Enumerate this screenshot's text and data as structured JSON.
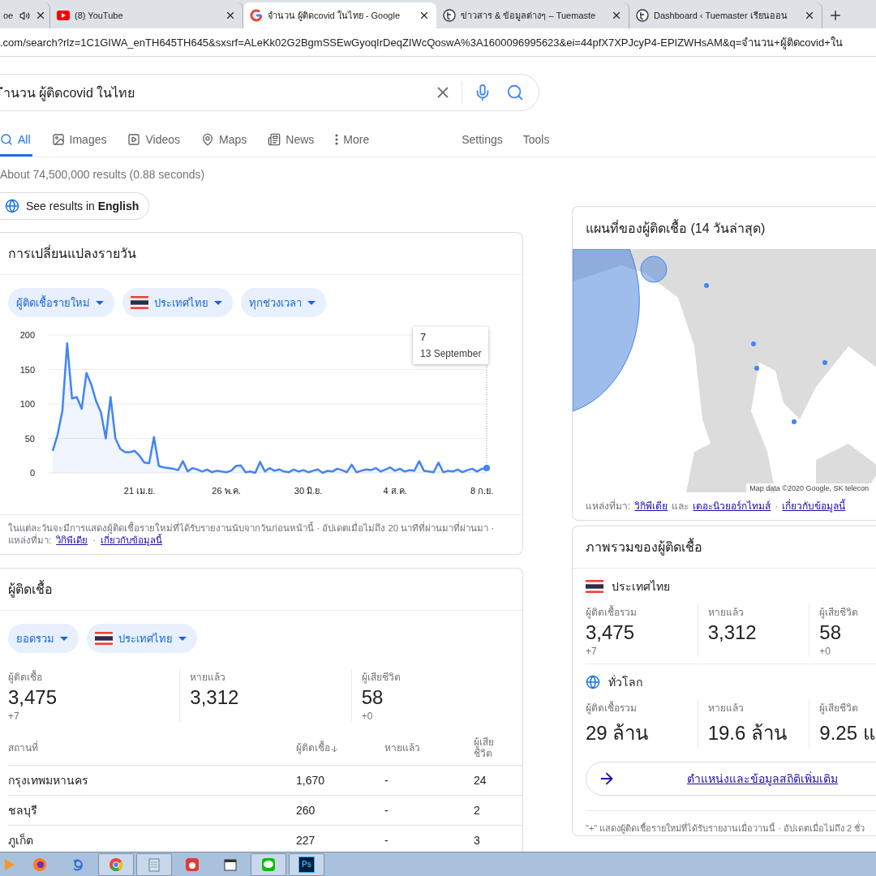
{
  "browser_tabs": [
    {
      "title": "oe",
      "kind": "audio",
      "selected": false
    },
    {
      "title": "(8) YouTube",
      "kind": "youtube",
      "selected": false
    },
    {
      "title": "จำนวน ผู้ติดcovid ในไทย - Google",
      "kind": "google",
      "selected": true
    },
    {
      "title": "ข่าวสาร & ข้อมูลต่างๆ – Tuemaste",
      "kind": "site",
      "selected": false
    },
    {
      "title": "Dashboard ‹ Tuemaster เรียนออน",
      "kind": "site",
      "selected": false
    }
  ],
  "address_bar": {
    "url": ".com/search?rlz=1C1GIWA_enTH645TH645&sxsrf=ALeKk02G2BgmSSEwGyoqIrDeqZIWcQoswA%3A1600096995623&ei=44pfX7XPJcyP4-EPIZWHsAM&q=จำนวน+ผู้ติดcovid+ใน"
  },
  "search": {
    "value": "ำนวน ผู้ติดcovid ในไทย"
  },
  "search_tabs": [
    {
      "label": "All",
      "kind": "all",
      "selected": true
    },
    {
      "label": "Images",
      "kind": "images",
      "selected": false
    },
    {
      "label": "Videos",
      "kind": "videos",
      "selected": false
    },
    {
      "label": "Maps",
      "kind": "maps",
      "selected": false
    },
    {
      "label": "News",
      "kind": "news",
      "selected": false
    },
    {
      "label": "More",
      "kind": "more",
      "selected": false
    }
  ],
  "search_tools": [
    "Settings",
    "Tools"
  ],
  "result_stats": "About 74,500,000 results (0.88 seconds)",
  "language_chip": "See results in **English**",
  "daily_card": {
    "title": "การเปลี่ยนแปลงรายวัน",
    "chips": [
      {
        "label": "ผู้ติดเชื้อรายใหม่",
        "kind": "metric"
      },
      {
        "label": "ประเทศไทย",
        "kind": "country"
      },
      {
        "label": "ทุกช่วงเวลา",
        "kind": "metric"
      }
    ],
    "tooltip": {
      "value": "7",
      "date": "13 September"
    },
    "chart_data": {
      "type": "area",
      "categories": [
        null,
        null,
        null,
        null,
        null,
        null,
        null,
        null,
        null,
        null,
        null,
        null,
        null,
        null,
        null,
        null,
        null,
        null,
        "21 เม.ย.",
        null,
        null,
        null,
        null,
        null,
        null,
        null,
        null,
        null,
        null,
        null,
        null,
        null,
        null,
        null,
        null,
        null,
        "26 พ.ค.",
        null,
        null,
        null,
        null,
        null,
        null,
        null,
        null,
        null,
        null,
        null,
        null,
        null,
        null,
        null,
        null,
        "30 มิ.ย.",
        null,
        null,
        null,
        null,
        null,
        null,
        null,
        null,
        null,
        null,
        null,
        null,
        null,
        null,
        null,
        null,
        null,
        "4 ส.ค.",
        null,
        null,
        null,
        null,
        null,
        null,
        null,
        null,
        null,
        null,
        null,
        null,
        null,
        null,
        null,
        null,
        null,
        "8 ก.ย.",
        null
      ],
      "series": [
        {
          "color": "#4285f4",
          "values": [
            32,
            55,
            90,
            188,
            108,
            110,
            93,
            145,
            128,
            104,
            88,
            50,
            110,
            50,
            35,
            30,
            30,
            32,
            25,
            15,
            14,
            52,
            10,
            8,
            7,
            6,
            4,
            17,
            2,
            7,
            5,
            2,
            5,
            1,
            3,
            2,
            1,
            3,
            10,
            11,
            1,
            2,
            0,
            16,
            2,
            7,
            3,
            5,
            2,
            1,
            5,
            2,
            4,
            1,
            3,
            5,
            0,
            3,
            2,
            6,
            4,
            1,
            12,
            1,
            3,
            5,
            4,
            7,
            2,
            5,
            8,
            3,
            6,
            2,
            4,
            3,
            17,
            3,
            2,
            1,
            15,
            1,
            3,
            2,
            5,
            1,
            4,
            6,
            2,
            6,
            7
          ]
        }
      ],
      "ylim": [
        0,
        200
      ],
      "grid": true,
      "yticks": [
        0,
        50,
        100,
        150,
        200
      ]
    },
    "note": "ในแต่ละวันจะมีการแสดงผู้ติดเชื้อรายใหม่ที่ได้รับรายงานนับจากวันก่อนหน้านี้ · อัปเดตเมื่อไม่ถึง 20 นาทีที่ผ่านมาที่ผ่านมา ·",
    "source_label": "แหล่งที่มา:",
    "links": [
      "วิกิพีเดีย",
      "เกี่ยวกับข้อมูลนี้"
    ],
    "separator": "·"
  },
  "cases_card": {
    "title": "ผู้ติดเชื้อ",
    "chips": [
      {
        "label": "ยอดรวม",
        "kind": "metric"
      },
      {
        "label": "ประเทศไทย",
        "kind": "country"
      }
    ],
    "stats": [
      {
        "label": "ผู้ติดเชื้อ",
        "value": "3,475",
        "delta": "+7"
      },
      {
        "label": "หายแล้ว",
        "value": "3,312"
      },
      {
        "label": "ผู้เสียชีวิต",
        "value": "58",
        "delta": "+0"
      }
    ],
    "table": {
      "columns": [
        {
          "label": "สถานที่",
          "sorted": false
        },
        {
          "label": "ผู้ติดเชื้อ",
          "sorted": true
        },
        {
          "label": "หายแล้ว",
          "sorted": false
        },
        {
          "label": "ผู้เสีย ชีวิต",
          "sorted": false
        }
      ],
      "rows": [
        [
          "กรุงเทพมหานคร",
          "1,670",
          "-",
          "24"
        ],
        [
          "ชลบุรี",
          "260",
          "-",
          "2"
        ],
        [
          "ภูเก็ต",
          "227",
          "-",
          "3"
        ]
      ]
    }
  },
  "map_card": {
    "title": "แผนที่ของผู้ติดเชื้อ (14 วันล่าสุด)",
    "attribution": "Map data ©2020 Google, SK telecon",
    "source_label": "แหล่งที่มา:",
    "links": [
      "วิกิพีเดีย",
      "เดอะนิวยอร์กไทมส์",
      "เกี่ยวกับข้อมูลนี้"
    ],
    "joiner": "และ",
    "separator": "·"
  },
  "overview_card": {
    "title": "ภาพรวมของผู้ติดเชื้อ",
    "sections": [
      {
        "kind": "country",
        "name": "ประเทศไทย",
        "stats": [
          {
            "label": "ผู้ติดเชื้อรวม",
            "value": "3,475",
            "delta": "+7"
          },
          {
            "label": "หายแล้ว",
            "value": "3,312"
          },
          {
            "label": "ผู้เสียชีวิต",
            "value": "58",
            "delta": "+0"
          }
        ]
      },
      {
        "kind": "world",
        "name": "ทั่วโลก",
        "stats": [
          {
            "label": "ผู้ติดเชื้อรวม",
            "value": "29 ล้าน"
          },
          {
            "label": "หายแล้ว",
            "value": "19.6 ล้าน"
          },
          {
            "label": "ผู้เสียชีวิต",
            "value": "9.25 แ"
          }
        ]
      }
    ],
    "more_link": "ตำแหน่งและข้อมูลสถิติเพิ่มเติม",
    "footnote": "\"+\" แสดงผู้ติดเชื้อรายใหม่ที่ได้รับรายงานเมื่อวานนี้ · อัปเดตเมื่อไม่ถึง 2 ชั่ว"
  },
  "taskbar": [
    {
      "kind": "media",
      "selected": false
    },
    {
      "kind": "firefox",
      "selected": false
    },
    {
      "kind": "swirl",
      "selected": false
    },
    {
      "kind": "chrome",
      "selected": true
    },
    {
      "kind": "notepad",
      "selected": true
    },
    {
      "kind": "record",
      "selected": false
    },
    {
      "kind": "calendar",
      "selected": false
    },
    {
      "kind": "chat",
      "selected": true
    },
    {
      "kind": "photoshop",
      "selected": true,
      "label": "Ps"
    }
  ]
}
